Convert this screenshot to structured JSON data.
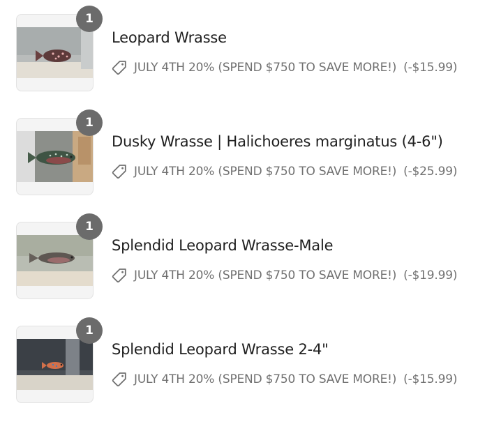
{
  "items": [
    {
      "title": "Leopard Wrasse",
      "quantity": "1",
      "discount_label": "JULY 4TH 20% (SPEND $750 TO SAVE MORE!)",
      "discount_amount": "(-$15.99)",
      "thumb_icon": "fish-photo"
    },
    {
      "title": "Dusky Wrasse | Halichoeres marginatus (4-6\")",
      "quantity": "1",
      "discount_label": "JULY 4TH 20% (SPEND $750 TO SAVE MORE!)",
      "discount_amount": "(-$25.99)",
      "thumb_icon": "fish-photo"
    },
    {
      "title": "Splendid Leopard Wrasse-Male",
      "quantity": "1",
      "discount_label": "JULY 4TH 20% (SPEND $750 TO SAVE MORE!)",
      "discount_amount": "(-$19.99)",
      "thumb_icon": "fish-photo"
    },
    {
      "title": "Splendid Leopard Wrasse 2-4\"",
      "quantity": "1",
      "discount_label": "JULY 4TH 20% (SPEND $750 TO SAVE MORE!)",
      "discount_amount": "(-$15.99)",
      "thumb_icon": "fish-photo"
    }
  ],
  "colors": {
    "badge": "#6b6b6b",
    "title_text": "#1f1f1f",
    "discount_text": "#707070"
  }
}
